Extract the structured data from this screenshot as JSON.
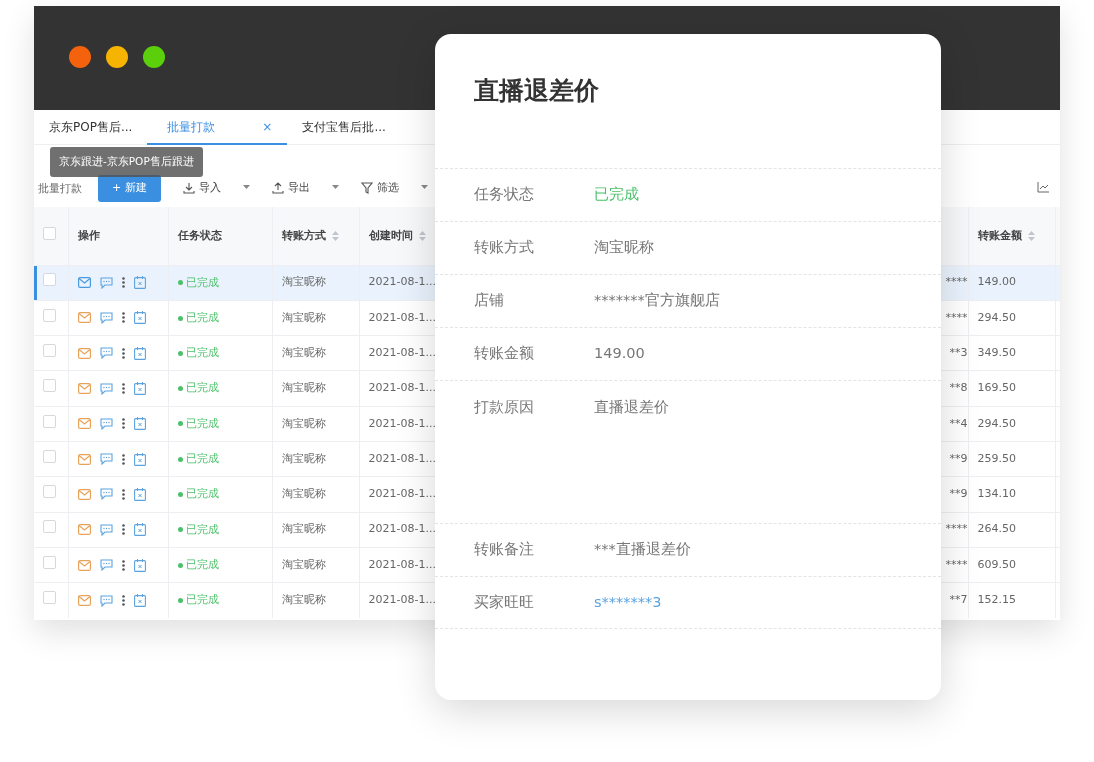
{
  "window": {
    "controls": [
      {
        "color": "#f4620e"
      },
      {
        "color": "#f6b400"
      },
      {
        "color": "#5ccf0c"
      }
    ]
  },
  "tabs": [
    {
      "label": "京东POP售后...",
      "selected": false
    },
    {
      "label": "批量打款",
      "selected": true,
      "close": "×"
    },
    {
      "label": "支付宝售后批...",
      "selected": false
    }
  ],
  "tooltip": {
    "text": "京东跟进-京东POP售后跟进"
  },
  "toolbar": {
    "view_select": "批量打款",
    "new_button": {
      "icon": "+",
      "label": "新建"
    },
    "actions": [
      {
        "kind": "import",
        "label": "导入"
      },
      {
        "kind": "export",
        "label": "导出"
      },
      {
        "kind": "filter",
        "label": "筛选"
      }
    ]
  },
  "table": {
    "header_checked": false,
    "columns": [
      {
        "label": "操作",
        "sortable": false
      },
      {
        "label": "任务状态",
        "sortable": false
      },
      {
        "label": "转账方式",
        "sortable": true
      },
      {
        "label": "创建时间",
        "sortable": true
      },
      {
        "label": "转账金额",
        "sortable": true
      }
    ],
    "rows": [
      {
        "selected": true,
        "status": "已完成",
        "method": "淘宝昵称",
        "created": "2021-08-1...",
        "column_7": "****",
        "amount": "149.00"
      },
      {
        "selected": false,
        "status": "已完成",
        "method": "淘宝昵称",
        "created": "2021-08-1...",
        "column_7": "****",
        "amount": "294.50"
      },
      {
        "selected": false,
        "status": "已完成",
        "method": "淘宝昵称",
        "created": "2021-08-1...",
        "column_7": "**3",
        "amount": "349.50"
      },
      {
        "selected": false,
        "status": "已完成",
        "method": "淘宝昵称",
        "created": "2021-08-1...",
        "column_7": "**8",
        "amount": "169.50"
      },
      {
        "selected": false,
        "status": "已完成",
        "method": "淘宝昵称",
        "created": "2021-08-1...",
        "column_7": "**4",
        "amount": "294.50"
      },
      {
        "selected": false,
        "status": "已完成",
        "method": "淘宝昵称",
        "created": "2021-08-1...",
        "column_7": "**9",
        "amount": "259.50"
      },
      {
        "selected": false,
        "status": "已完成",
        "method": "淘宝昵称",
        "created": "2021-08-1...",
        "column_7": "**9",
        "amount": "134.10"
      },
      {
        "selected": false,
        "status": "已完成",
        "method": "淘宝昵称",
        "created": "2021-08-1...",
        "column_7": "****",
        "amount": "264.50"
      },
      {
        "selected": false,
        "status": "已完成",
        "method": "淘宝昵称",
        "created": "2021-08-1...",
        "column_7": "****",
        "amount": "609.50"
      },
      {
        "selected": false,
        "status": "已完成",
        "method": "淘宝昵称",
        "created": "2021-08-1...",
        "column_7": "**7",
        "amount": "152.15"
      }
    ]
  },
  "detail": {
    "title": "直播退差价",
    "fields": [
      {
        "kind": "status",
        "label": "任务状态",
        "value": "已完成"
      },
      {
        "kind": "text",
        "label": "转账方式",
        "value": "淘宝昵称"
      },
      {
        "kind": "text",
        "label": "店铺",
        "value": "*******官方旗舰店"
      },
      {
        "kind": "text",
        "label": "转账金额",
        "value": "149.00"
      },
      {
        "kind": "multiline",
        "label": "打款原因",
        "value": "直播退差价"
      },
      {
        "kind": "text",
        "label": "转账备注",
        "value": "***直播退差价"
      },
      {
        "kind": "link",
        "label": "买家旺旺",
        "value": "s*******3"
      }
    ]
  }
}
